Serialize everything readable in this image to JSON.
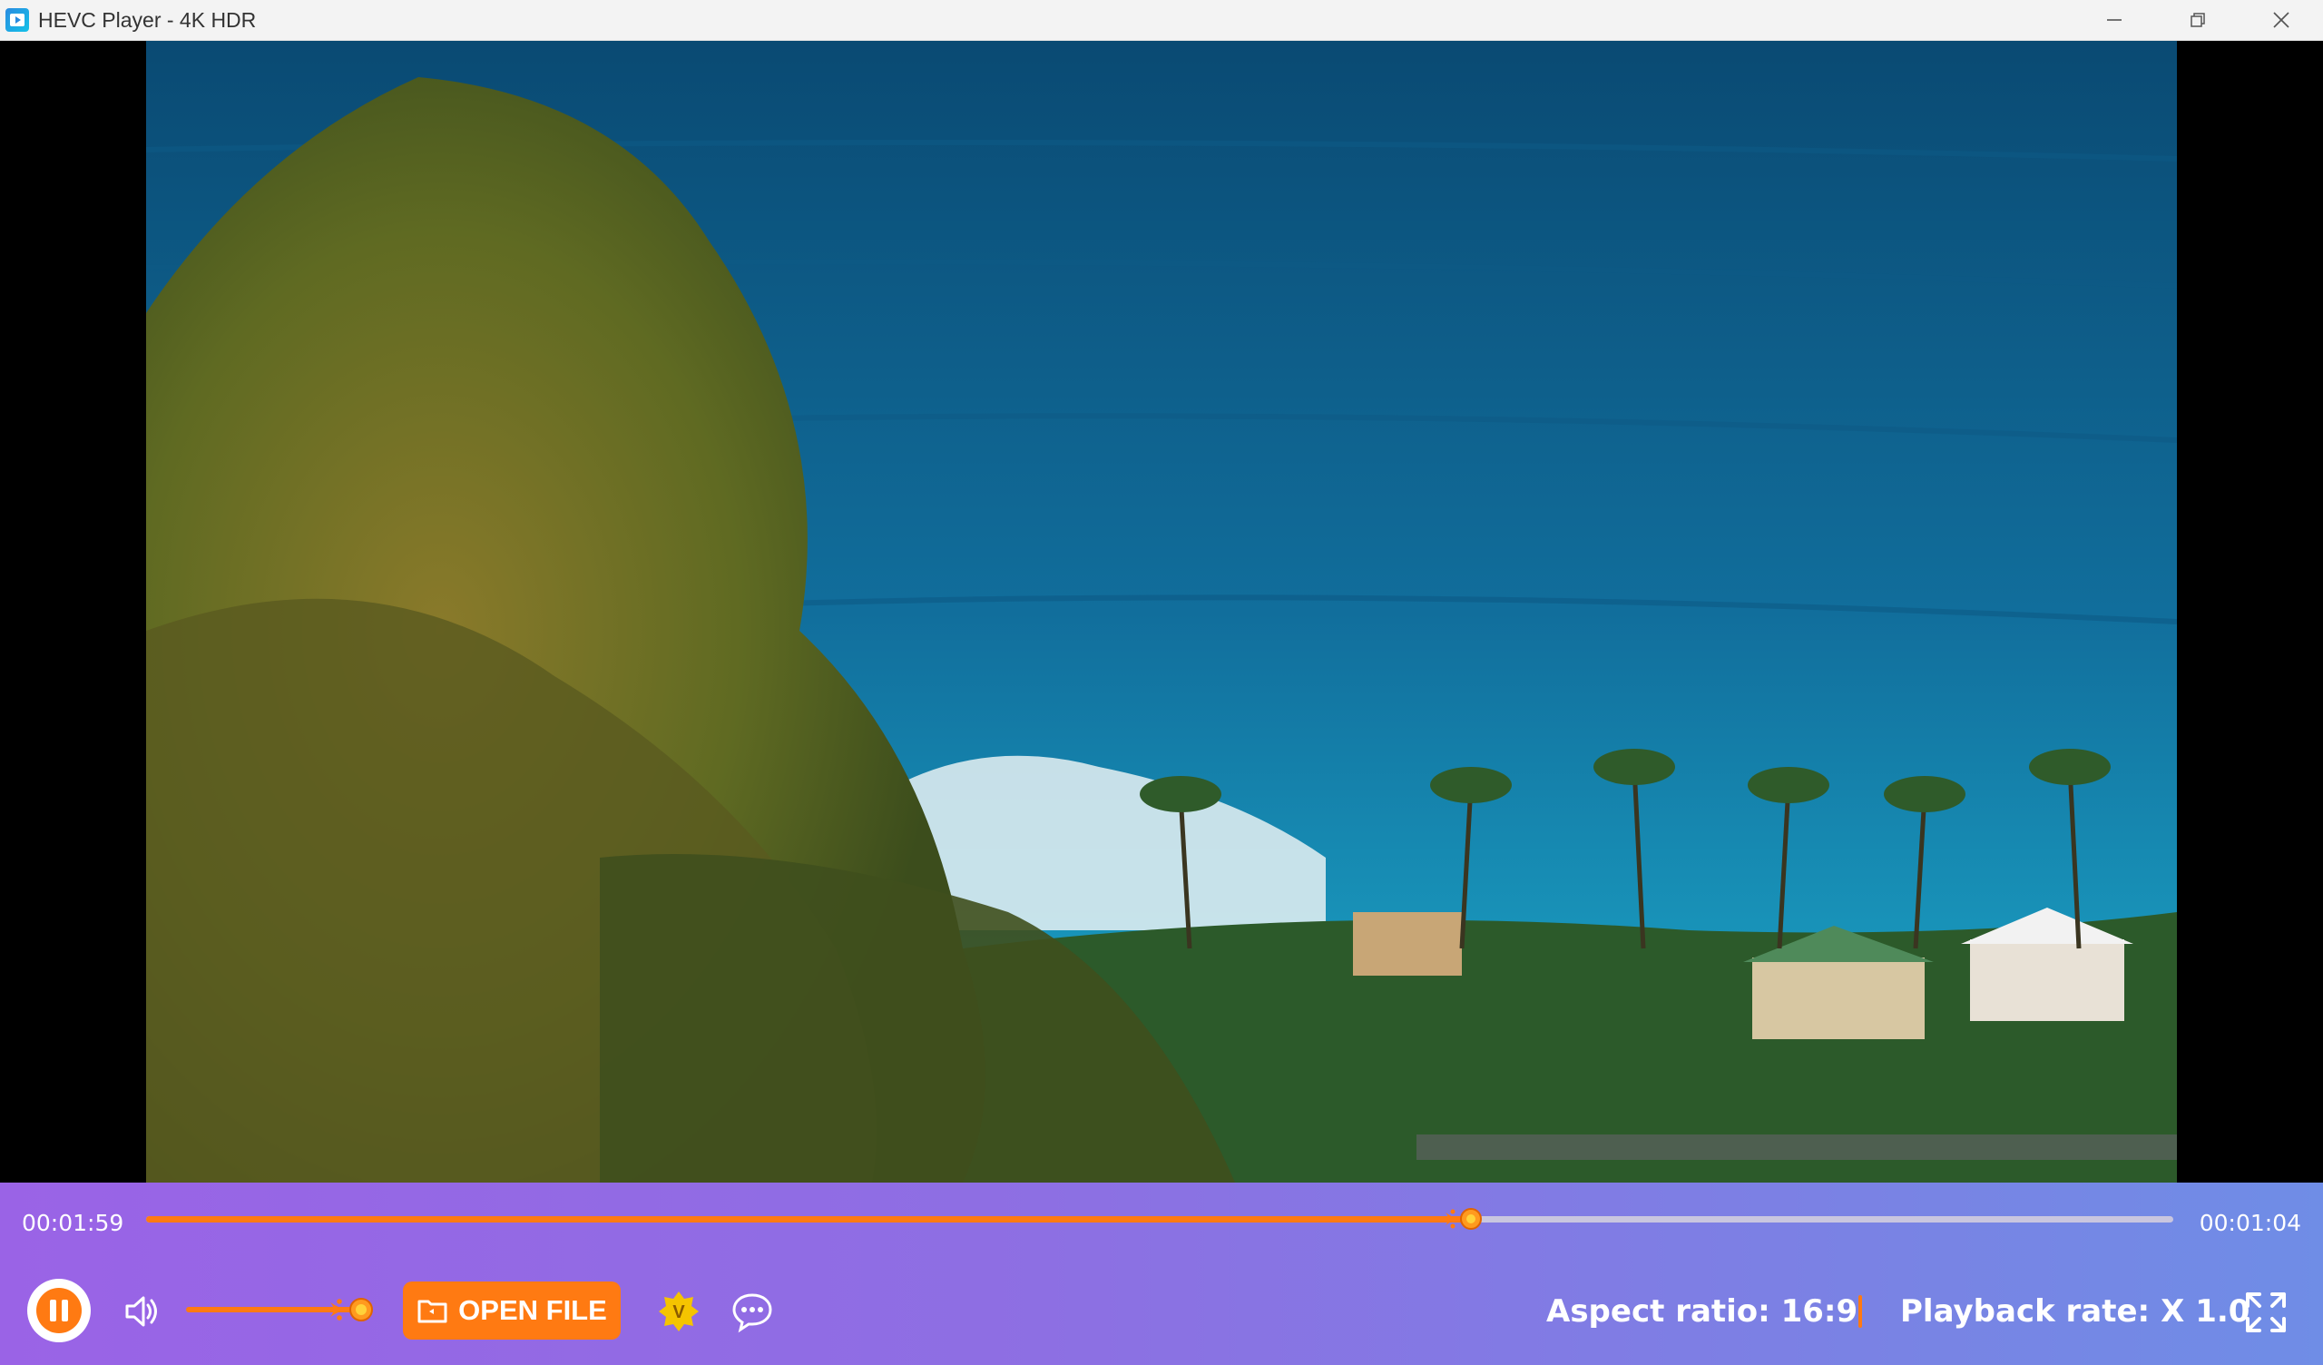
{
  "window": {
    "title": "HEVC Player - 4K HDR",
    "controls": [
      "minimize-icon",
      "restore-icon",
      "close-icon"
    ]
  },
  "video": {
    "description_icon": "video-frame"
  },
  "player": {
    "elapsed": "00:01:59",
    "remaining": "00:01:04",
    "progress_fraction": 0.65,
    "volume_fraction": 1.0,
    "open_file_label": "OPEN FILE",
    "aspect_label": "Aspect ratio:",
    "aspect_value": "16:9",
    "rate_label": "Playback rate:",
    "rate_value": "X 1.0"
  },
  "colors": {
    "accent": "#ff7a12",
    "bar_start": "#9a63e6",
    "bar_end": "#6f8de6",
    "vip": "#f5c400"
  }
}
